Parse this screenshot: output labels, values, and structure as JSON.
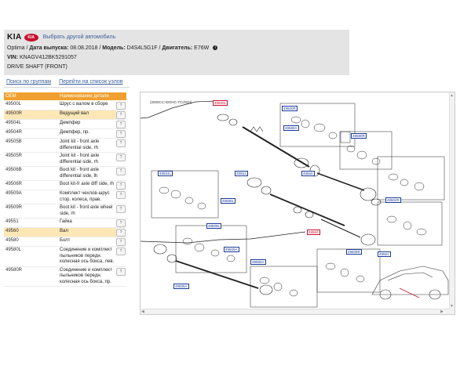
{
  "header": {
    "brand": "KIA",
    "logo_text": "KIA",
    "change_link": "Выбрать другой автомобиль",
    "model_name": "Optima",
    "date_label": "Дата выпуска:",
    "date_value": "08.08.2018",
    "model_label": "Модель:",
    "model_value": "D4S4L5G1F",
    "engine_label": "Двигатель:",
    "engine_value": "E76W",
    "vin_label": "VIN:",
    "vin_value": "KNAGV412BK5291057",
    "section": "DRIVE SHAFT (FRONT)"
  },
  "nav": {
    "search_groups": "Поиск по группам",
    "to_nodes": "Перейти на список узлов"
  },
  "table": {
    "col_oem": "OEM",
    "col_name": "Наименование детали",
    "rows": [
      {
        "num": "49500L",
        "name": "Шрус с валом в сборе"
      },
      {
        "num": "49500R",
        "name": "Ведущий вал"
      },
      {
        "num": "49504L",
        "name": "Демпфер"
      },
      {
        "num": "49504R",
        "name": "Демпфер, пр."
      },
      {
        "num": "49505B",
        "name": "Joint kit - front axle differential side, rh"
      },
      {
        "num": "49505R",
        "name": "Joint kit - front axle differential side, rh"
      },
      {
        "num": "49506B",
        "name": "Boot kit - front axle differential side, lh"
      },
      {
        "num": "49506R",
        "name": "Boot kit-fr axle diff side, rh"
      },
      {
        "num": "49509A",
        "name": "Комплект чехлов-шрус стор. колеса, прав."
      },
      {
        "num": "49509R",
        "name": "Boot kit - front axle wheel side, rh"
      },
      {
        "num": "49551",
        "name": "Гайка"
      },
      {
        "num": "49560",
        "name": "Вал"
      },
      {
        "num": "49580",
        "name": "Болт"
      },
      {
        "num": "49580L",
        "name": "Соединение и комплект пыльников передн. колесная ось бокса, лев."
      },
      {
        "num": "49580R",
        "name": "Соединение и комплект пыльников передн. колесная ось бокса, пр."
      }
    ],
    "button_glyph": "?"
  },
  "diagram": {
    "engine_note": "(2000CC>DOHC-TCI/GDI)",
    "callouts": [
      {
        "text": "49500L",
        "red": true
      },
      {
        "text": "49500R",
        "red": false
      },
      {
        "text": "49580A",
        "red": false
      },
      {
        "text": "49580R",
        "red": false
      },
      {
        "text": "49504L",
        "red": false
      },
      {
        "text": "49551",
        "red": false
      },
      {
        "text": "49560",
        "red": false
      },
      {
        "text": "49504R",
        "red": false
      },
      {
        "text": "49509L",
        "red": false
      },
      {
        "text": "49580L",
        "red": false
      },
      {
        "text": "49560",
        "red": true
      },
      {
        "text": "49509A",
        "red": false
      },
      {
        "text": "49580A",
        "red": false
      },
      {
        "text": "49551",
        "red": false
      },
      {
        "text": "49509R",
        "red": false
      },
      {
        "text": "49505A",
        "red": false
      }
    ]
  }
}
